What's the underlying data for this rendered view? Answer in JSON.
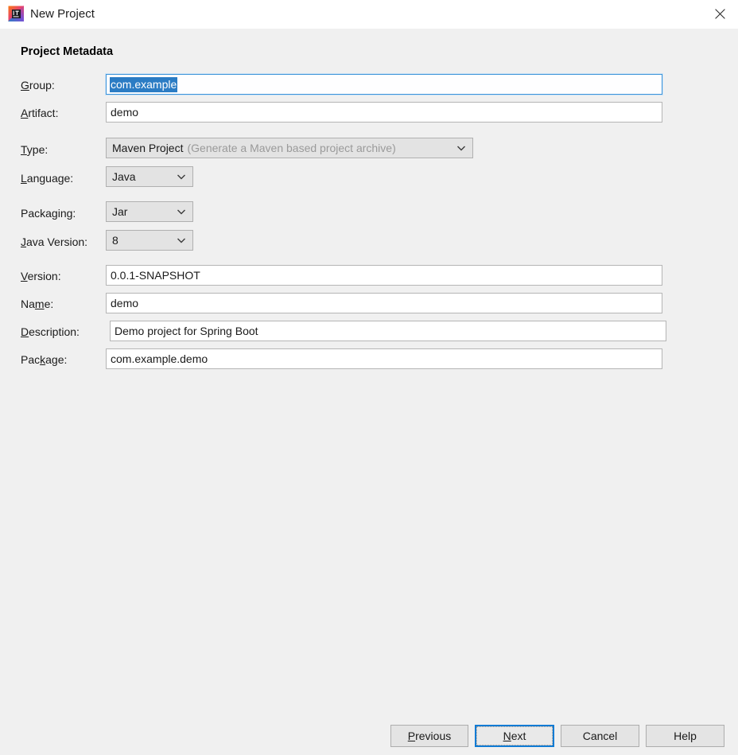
{
  "window": {
    "title": "New Project",
    "app_icon": "intellij-idea-icon",
    "close_icon": "close-icon"
  },
  "section": {
    "heading": "Project Metadata"
  },
  "fields": {
    "group": {
      "label_pre": "",
      "label_mnemonic": "G",
      "label_post": "roup:",
      "value": "com.example",
      "selected": true
    },
    "artifact": {
      "label_pre": "",
      "label_mnemonic": "A",
      "label_post": "rtifact:",
      "value": "demo"
    },
    "type": {
      "label_pre": "",
      "label_mnemonic": "T",
      "label_post": "ype:",
      "value": "Maven Project",
      "hint": "(Generate a Maven based project archive)"
    },
    "language": {
      "label_pre": "",
      "label_mnemonic": "L",
      "label_post": "anguage:",
      "value": "Java"
    },
    "packaging": {
      "label_pre": "Packa",
      "label_mnemonic": "g",
      "label_post": "ing:",
      "value": "Jar"
    },
    "java_version": {
      "label_pre": "",
      "label_mnemonic": "J",
      "label_post": "ava Version:",
      "value": "8"
    },
    "version": {
      "label_pre": "",
      "label_mnemonic": "V",
      "label_post": "ersion:",
      "value": "0.0.1-SNAPSHOT"
    },
    "name": {
      "label_pre": "Na",
      "label_mnemonic": "m",
      "label_post": "e:",
      "value": "demo"
    },
    "description": {
      "label_pre": "",
      "label_mnemonic": "D",
      "label_post": "escription:",
      "value": "Demo project for Spring Boot"
    },
    "package": {
      "label_pre": "Pac",
      "label_mnemonic": "k",
      "label_post": "age:",
      "value": "com.example.demo"
    }
  },
  "buttons": {
    "previous": {
      "pre": "",
      "mnemonic": "P",
      "post": "revious"
    },
    "next": {
      "pre": "",
      "mnemonic": "N",
      "post": "ext",
      "is_default": true
    },
    "cancel": {
      "pre": "Cancel",
      "mnemonic": "",
      "post": ""
    },
    "help": {
      "pre": "Help",
      "mnemonic": "",
      "post": ""
    }
  },
  "colors": {
    "window_bg": "#f0f0f0",
    "titlebar_bg": "#ffffff",
    "field_bg": "#ffffff",
    "combo_bg": "#e3e3e3",
    "selection_bg": "#2b7cc4",
    "focus_border": "#3d94d9",
    "default_button_border": "#0f7bd4",
    "hint_text": "#9a9a9a"
  }
}
